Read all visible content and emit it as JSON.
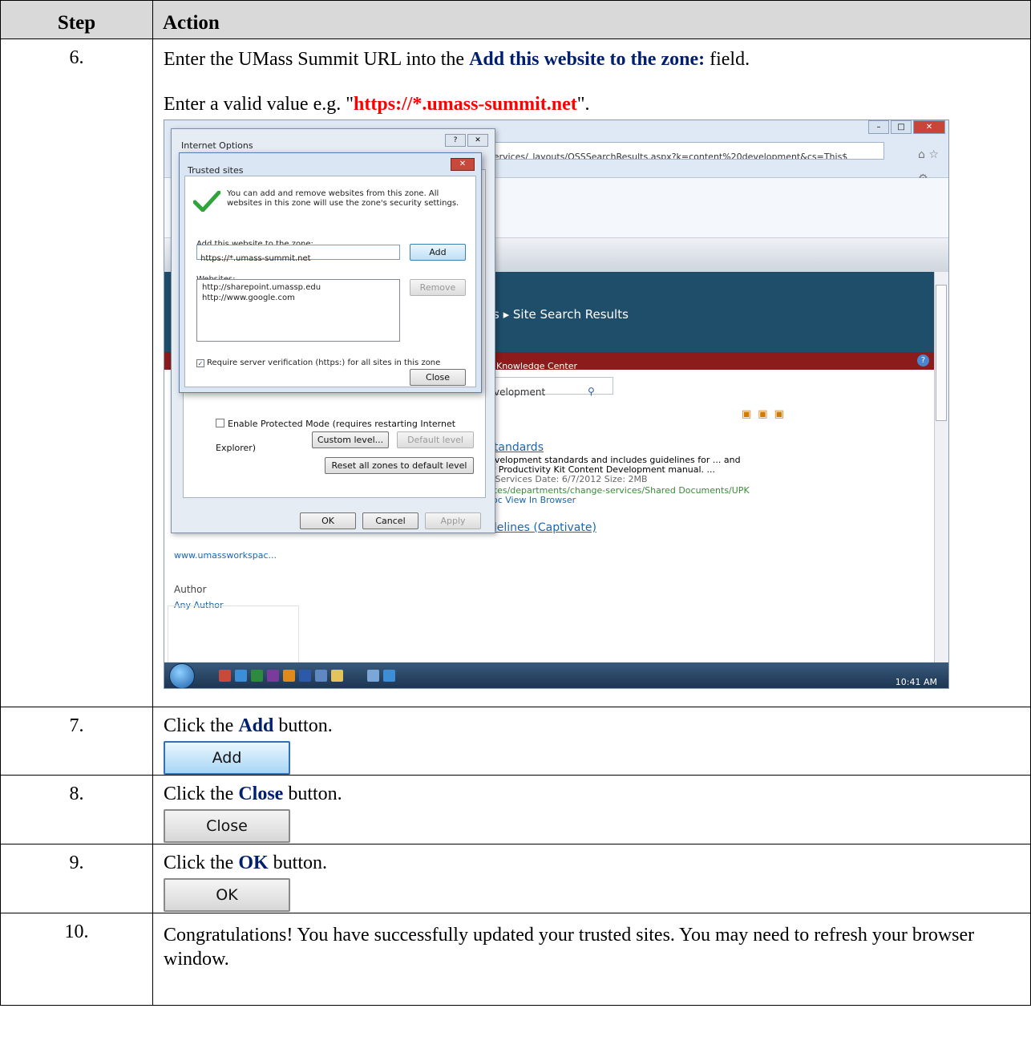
{
  "table": {
    "col_step": "Step",
    "col_action": "Action"
  },
  "rows": [
    {
      "step": "6.",
      "line1_pre": "Enter the UMass Summit URL into the ",
      "line1_kw": "Add this website to the zone:",
      "line1_post": " field.",
      "line2_pre": "Enter a valid value e.g. \"",
      "line2_url": "https://*.umass-summit.net",
      "line2_post": "\"."
    },
    {
      "step": "7.",
      "pre": "Click the ",
      "kw": "Add",
      "post": " button.",
      "button": "Add"
    },
    {
      "step": "8.",
      "pre": "Click the ",
      "kw": "Close",
      "post": " button.",
      "button": "Close"
    },
    {
      "step": "9.",
      "pre": "Click the ",
      "kw": "OK",
      "post": " button.",
      "button": "OK"
    },
    {
      "step": "10.",
      "text": "Congratulations! You have successfully updated your trusted sites. You may need to refresh your browser window."
    }
  ],
  "screenshot": {
    "address": "services/_layouts/OSSSearchResults.aspx?k=content%20development&cs=This$",
    "breadcrumb": "s  ▸ Site Search Results",
    "kc_label": "Knowledge Center",
    "search_value": "velopment",
    "result1_title": "Standards",
    "result1_l1": "levelopment standards and includes guidelines for ... and",
    "result1_l2": "er Productivity Kit Content Development manual. ...",
    "result1_l3": "n Services  Date: 6/7/2012  Size: 2MB",
    "result1_l4": "sites/departments/change-services/Shared Documents/UPK",
    "result1_l5": "doc  View In Browser",
    "result2_title": "idelines (Captivate)",
    "left_site": "www.umassworkspac...",
    "left_author": "Author",
    "left_any_author": "Any Author",
    "clock": "10:41 AM",
    "outer_dialog": {
      "title": "Internet Options",
      "protected_mode": "Enable Protected Mode (requires restarting Internet Explorer)",
      "custom_level": "Custom level...",
      "default_level": "Default level",
      "reset_all": "Reset all zones to default level",
      "ok": "OK",
      "cancel": "Cancel",
      "apply": "Apply"
    },
    "inner_dialog": {
      "title": "Trusted sites",
      "info": "You can add and remove websites from this zone. All websites in this zone will use the zone's security settings.",
      "add_label": "Add this website to the zone:",
      "add_value": "https://*.umass-summit.net",
      "add_button": "Add",
      "websites_label": "Websites:",
      "sites": [
        "http://sharepoint.umassp.edu",
        "http://www.google.com"
      ],
      "remove_button": "Remove",
      "require_https": "Require server verification (https:) for all sites in this zone",
      "close_button": "Close"
    }
  },
  "colors": {
    "keyword": "#00206f",
    "url": "#ff0000",
    "header_bg": "#d9d9d9"
  }
}
